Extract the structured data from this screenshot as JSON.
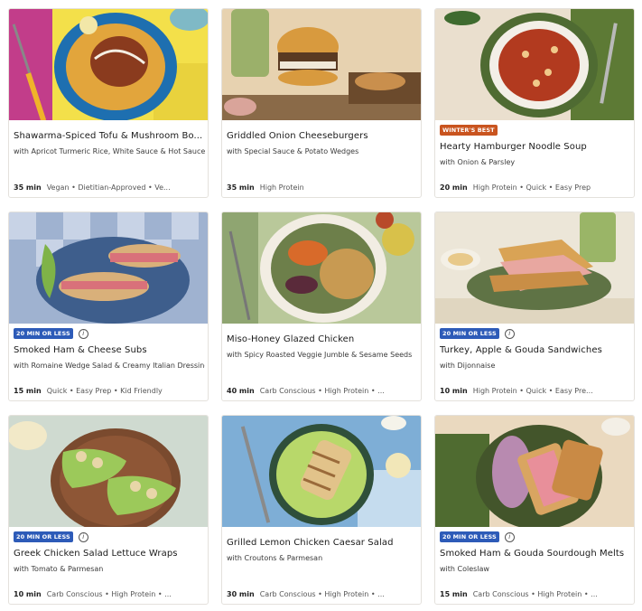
{
  "recipes": [
    {
      "badge": "",
      "badge_color": "",
      "title": "Shawarma-Spiced Tofu & Mushroom Bo...",
      "subtitle": "with Apricot Turmeric Rice, White Sauce & Hot Sauce",
      "time": "35 min",
      "tags": "Vegan • Dietitian-Approved • Ve..."
    },
    {
      "badge": "",
      "badge_color": "",
      "title": "Griddled Onion Cheeseburgers",
      "subtitle": "with Special Sauce & Potato Wedges",
      "time": "35 min",
      "tags": "High Protein"
    },
    {
      "badge": "WINTER'S BEST",
      "badge_color": "#c9541f",
      "title": "Hearty Hamburger Noodle Soup",
      "subtitle": "with Onion & Parsley",
      "time": "20 min",
      "tags": "High Protein • Quick • Easy Prep"
    },
    {
      "badge": "20 MIN OR LESS",
      "badge_color": "#2d5bb8",
      "title": "Smoked Ham & Cheese Subs",
      "subtitle": "with Romaine Wedge Salad & Creamy Italian Dressing",
      "time": "15 min",
      "tags": "Quick • Easy Prep • Kid Friendly"
    },
    {
      "badge": "",
      "badge_color": "",
      "title": "Miso-Honey Glazed Chicken",
      "subtitle": "with Spicy Roasted Veggie Jumble & Sesame Seeds",
      "time": "40 min",
      "tags": "Carb Conscious • High Protein • ..."
    },
    {
      "badge": "20 MIN OR LESS",
      "badge_color": "#2d5bb8",
      "title": "Turkey, Apple & Gouda Sandwiches",
      "subtitle": "with Dijonnaise",
      "time": "10 min",
      "tags": "High Protein • Quick • Easy Pre..."
    },
    {
      "badge": "20 MIN OR LESS",
      "badge_color": "#2d5bb8",
      "title": "Greek Chicken Salad Lettuce Wraps",
      "subtitle": "with Tomato & Parmesan",
      "time": "10 min",
      "tags": "Carb Conscious • High Protein • ..."
    },
    {
      "badge": "",
      "badge_color": "",
      "title": "Grilled Lemon Chicken Caesar Salad",
      "subtitle": "with Croutons & Parmesan",
      "time": "30 min",
      "tags": "Carb Conscious • High Protein • ..."
    },
    {
      "badge": "20 MIN OR LESS",
      "badge_color": "#2d5bb8",
      "title": "Smoked Ham & Gouda Sourdough Melts",
      "subtitle": "with Coleslaw",
      "time": "15 min",
      "tags": "Carb Conscious • High Protein • ..."
    }
  ],
  "info_symbol": "i"
}
